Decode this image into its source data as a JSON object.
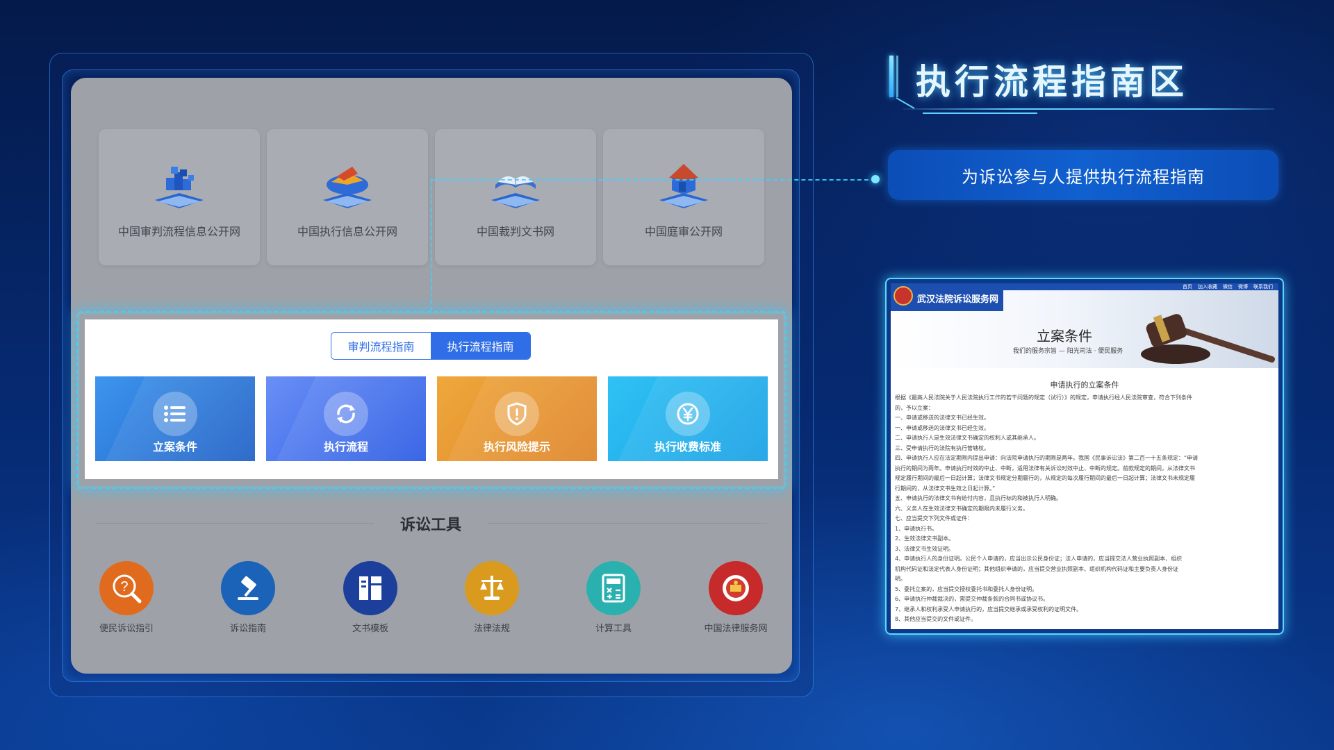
{
  "header": {
    "title": "执行流程指南区",
    "subtitle": "为诉讼参与人提供执行流程指南"
  },
  "sites": [
    {
      "label": "中国审判流程信息公开网",
      "icon": "blocks-3d-icon",
      "color": "#2a66cf"
    },
    {
      "label": "中国执行信息公开网",
      "icon": "chart-3d-icon",
      "color": "#2a66cf"
    },
    {
      "label": "中国裁判文书网",
      "icon": "book-3d-icon",
      "color": "#2a66cf"
    },
    {
      "label": "中国庭审公开网",
      "icon": "house-3d-icon",
      "color": "#c84a2e"
    }
  ],
  "guide": {
    "tabs": [
      {
        "label": "审判流程指南",
        "active": false
      },
      {
        "label": "执行流程指南",
        "active": true
      }
    ],
    "tiles": [
      {
        "label": "立案条件",
        "icon": "list-icon",
        "color_from": "#3a8ee8",
        "color_to": "#1f5fc6"
      },
      {
        "label": "执行流程",
        "icon": "refresh-icon",
        "color_from": "#5b86f4",
        "color_to": "#2c5ee6"
      },
      {
        "label": "执行风险提示",
        "icon": "shield-alert-icon",
        "color_from": "#eda23a",
        "color_to": "#e1882a"
      },
      {
        "label": "执行收费标准",
        "icon": "yen-icon",
        "color_from": "#2ab8f0",
        "color_to": "#1aa0e8"
      }
    ]
  },
  "tools": {
    "title": "诉讼工具",
    "items": [
      {
        "label": "便民诉讼指引",
        "icon": "help-search-icon",
        "color": "#e06b1f"
      },
      {
        "label": "诉讼指南",
        "icon": "gavel-icon",
        "color": "#1a63b8"
      },
      {
        "label": "文书模板",
        "icon": "template-icon",
        "color": "#1c3f9c"
      },
      {
        "label": "法律法规",
        "icon": "scales-icon",
        "color": "#d99a1e"
      },
      {
        "label": "计算工具",
        "icon": "calculator-icon",
        "color": "#2bb0b0"
      },
      {
        "label": "中国法律服务网",
        "icon": "emblem-icon",
        "color": "#c62a2a"
      }
    ]
  },
  "screenshot": {
    "site_name": "武汉法院诉讼服务网",
    "nav": [
      "首页",
      "加入收藏",
      "微信",
      "微博",
      "联系我们"
    ],
    "banner_title": "立案条件",
    "banner_sub": "我们的服务宗旨 — 阳光司法 · 便民服务",
    "doc_title": "申请执行的立案条件",
    "lines": [
      "根据《最高人民法院关于人民法院执行工作的若干问题的规定（试行）》的规定，申请执行经人民法院审查，符合下列条件",
      "的，予以立案：",
      "一、申请或移送的法律文书已经生效。",
      "一、申请或移送的法律文书已经生效。",
      "二、申请执行人是生效法律文书确定的权利人或其继承人。",
      "三、受申请执行的法院有执行管辖权。",
      "四、申请执行人应在法定期限内提出申请：向法院申请执行的期限是两年。我国《民事诉讼法》第二百一十五条规定：“申请",
      "执行的期间为两年。申请执行时效的中止、中断，适用法律有关诉讼时效中止、中断的规定。前款规定的期间，从法律文书",
      "规定履行期间的最后一日起计算；法律文书规定分期履行的，从规定的每次履行期间的最后一日起计算；法律文书未规定履",
      "行期间的，从法律文书生效之日起计算。”",
      "五、申请执行的法律文书有给付内容，且执行标的和被执行人明确。",
      "六、义务人在生效法律文书确定的期限内未履行义务。",
      "七、应当提交下列文件或证件：",
      "    1、申请执行书。",
      "    2、生效法律文书副本。",
      "    3、法律文书生效证明。",
      "    4、申请执行人的身份证明。公民个人申请的，应当出示公民身份证；法人申请的，应当提交法人营业执照副本、组织",
      "    机构代码证和法定代表人身份证明；其他组织申请的，应当提交营业执照副本、组织机构代码证和主要负责人身份证",
      "    明。",
      "    5、委托立案的，应当提交授权委托书和委托人身份证明。",
      "    6、申请执行仲裁裁决的，需提交仲裁条款的合同书或协议书。",
      "    7、继承人和权利承受人申请执行的，应当提交继承或承受权利的证明文件。",
      "    8、其他应当提交的文件或证件。"
    ]
  }
}
